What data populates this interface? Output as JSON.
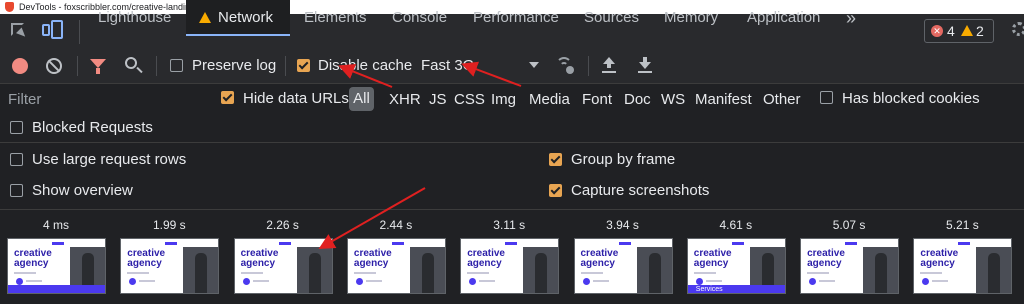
{
  "window": {
    "title": "DevTools - foxscribbler.com/creative-landing-page/"
  },
  "tabs": [
    {
      "label": "Lighthouse",
      "active": false
    },
    {
      "label": "Network",
      "active": true,
      "warning": true
    },
    {
      "label": "Elements",
      "active": false
    },
    {
      "label": "Console",
      "active": false
    },
    {
      "label": "Performance",
      "active": false
    },
    {
      "label": "Sources",
      "active": false
    },
    {
      "label": "Memory",
      "active": false
    },
    {
      "label": "Application",
      "active": false
    }
  ],
  "more_tabs_glyph": "»",
  "issues": {
    "errors": "4",
    "warnings": "2",
    "error_glyph": "✕"
  },
  "toolbar": {
    "preserve_log": {
      "label": "Preserve log",
      "checked": false
    },
    "disable_cache": {
      "label": "Disable cache",
      "checked": true
    },
    "throttling": "Fast 3G"
  },
  "filter": {
    "placeholder": "Filter",
    "hide_data_urls": {
      "label": "Hide data URLs",
      "checked": true
    },
    "types": [
      "All",
      "XHR",
      "JS",
      "CSS",
      "Img",
      "Media",
      "Font",
      "Doc",
      "WS",
      "Manifest",
      "Other"
    ],
    "active_type": "All",
    "blocked_cookies": {
      "label": "Has blocked cookies",
      "checked": false
    },
    "blocked_requests": {
      "label": "Blocked Requests",
      "checked": false
    }
  },
  "settings": {
    "large_rows": {
      "label": "Use large request rows",
      "checked": false
    },
    "show_overview": {
      "label": "Show overview",
      "checked": false
    },
    "group_by_frame": {
      "label": "Group by frame",
      "checked": true
    },
    "capture_screenshots": {
      "label": "Capture screenshots",
      "checked": true
    }
  },
  "screenshots": {
    "times": [
      "4 ms",
      "1.99 s",
      "2.26 s",
      "2.44 s",
      "3.11 s",
      "3.94 s",
      "4.61 s",
      "5.07 s",
      "5.21 s"
    ],
    "thumbnail": {
      "heading_line1": "creative",
      "heading_line2": "agency",
      "footer_label": "Services"
    }
  },
  "colors": {
    "accent_checkbox": "#e8a552",
    "record": "#f28b82",
    "warning": "#f9ab00",
    "annotation_arrow": "#e02020",
    "thumbnail_brand": "#4b39ef"
  }
}
